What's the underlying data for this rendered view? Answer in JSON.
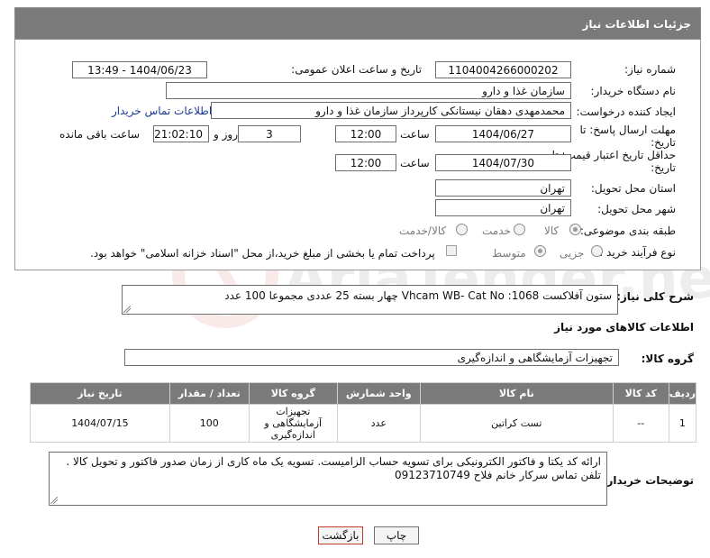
{
  "header": {
    "title": "جزئیات اطلاعات نیاز"
  },
  "form": {
    "need_number_label": "شماره نیاز:",
    "need_number": "1104004266000202",
    "announce_label": "تاریخ و ساعت اعلان عمومی:",
    "announce_value": "1404/06/23 - 13:49",
    "buyer_org_label": "نام دستگاه خریدار:",
    "buyer_org": "سازمان غذا و دارو",
    "requester_label": "ایجاد کننده درخواست:",
    "requester": "محمدمهدی دهقان نیستانکی کارپرداز سازمان غذا و دارو",
    "contact_link": "اطلاعات تماس خریدار",
    "deadline_label": "مهلت ارسال پاسخ: تا تاریخ:",
    "deadline_date": "1404/06/27",
    "time_label": "ساعت",
    "deadline_time": "12:00",
    "days_value": "3",
    "days_label": "روز و",
    "remaining_time": "21:02:10",
    "remaining_label": "ساعت باقی مانده",
    "validity_label": "حداقل تاریخ اعتبار قیمت: تا تاریخ:",
    "validity_date": "1404/07/30",
    "validity_time": "12:00",
    "province_label": "استان محل تحویل:",
    "province": "تهران",
    "city_label": "شهر محل تحویل:",
    "city": "تهران",
    "category_label": "طبقه بندی موضوعی:",
    "category_options": [
      "کالا",
      "خدمت",
      "کالا/خدمت"
    ],
    "process_label": "نوع فرآیند خرید :",
    "process_options": [
      "جزیی",
      "متوسط"
    ],
    "payment_note": "پرداخت تمام یا بخشی از مبلغ خرید،از محل \"اسناد خزانه اسلامی\" خواهد بود."
  },
  "general_desc": {
    "label": "شرح کلی نیاز:",
    "value": "ستون آفلاکست Vhcam WB- Cat No :1068 چهار بسته 25 عددی مجموعا 100 عدد"
  },
  "goods_info": {
    "title": "اطلاعات کالاهای مورد نیاز",
    "group_label": "گروه کالا:",
    "group_value": "تجهیزات آزمایشگاهی و اندازه‌گیری"
  },
  "table": {
    "headers": [
      "ردیف",
      "کد کالا",
      "نام کالا",
      "واحد شمارش",
      "گروه کالا",
      "تعداد / مقدار",
      "تاریخ نیاز"
    ],
    "rows": [
      [
        "1",
        "--",
        "تست کراتین",
        "عدد",
        "تجهیزات آزمایشگاهی و اندازه‌گیری",
        "100",
        "1404/07/15"
      ]
    ]
  },
  "buyer_notes": {
    "label": "توضیحات خریدار:",
    "value": "ارائه کد یکتا و فاکتور الکترونیکی برای تسویه حساب الزامیست. تسویه یک ماه کاری از زمان صدور فاکتور و تحویل کالا . تلفن تماس سرکار خانم فلاح 09123710749"
  },
  "buttons": {
    "print": "چاپ",
    "back": "بازگشت"
  },
  "watermark": {
    "text": "AriaTender.net"
  },
  "colors": {
    "header_bg": "#7a7a7a",
    "link": "#1a3a99",
    "back_button_border": "#c0392b"
  }
}
